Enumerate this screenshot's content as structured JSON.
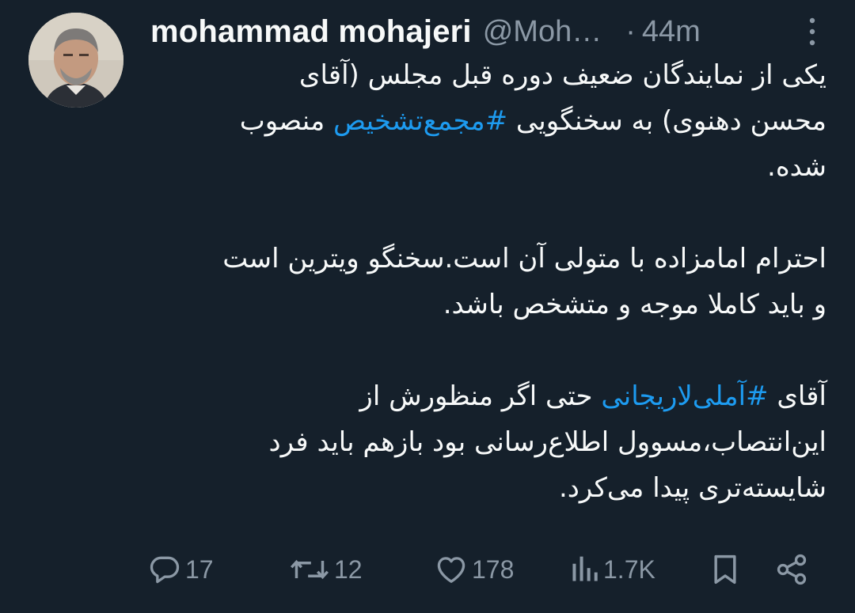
{
  "author": {
    "display_name": "mohammad mohajeri",
    "handle": "@Moh…",
    "separator": "·",
    "time": "44m"
  },
  "tweet": {
    "paragraphs": [
      {
        "line1": "یکی از نمایندگان ضعیف دوره قبل مجلس (آقای",
        "line2_before": "محسن دهنوی) به سخنگویی ",
        "hashtag": "#مجمع‌تشخیص",
        "line2_after": " منصوب",
        "line3": "شده."
      },
      {
        "line1": "احترام امامزاده با متولی آن است.سخنگو ویترین است",
        "line2": "و باید کاملا موجه و متشخص باشد."
      },
      {
        "line1_before": "آقای ",
        "hashtag": "#آملی‌لاریجانی",
        "line1_after": " حتی اگر منظورش از",
        "line2": "این‌انتصاب،مسوول اطلاع‌رسانی بود بازهم باید فرد",
        "line3": "شایسته‌تری پیدا می‌کرد."
      }
    ],
    "hashtag_color": "#1d9bf0"
  },
  "actions": {
    "replies": "17",
    "retweets": "12",
    "likes": "178",
    "views": "1.7K"
  },
  "icons": {
    "reply": "reply-icon",
    "retweet": "retweet-icon",
    "like": "heart-icon",
    "views": "views-icon",
    "bookmark": "bookmark-icon",
    "share": "share-icon",
    "more": "more-vertical-icon"
  },
  "colors": {
    "background": "#15202b",
    "text": "#f7f9f9",
    "secondary": "#8b98a5",
    "accent": "#1d9bf0"
  }
}
